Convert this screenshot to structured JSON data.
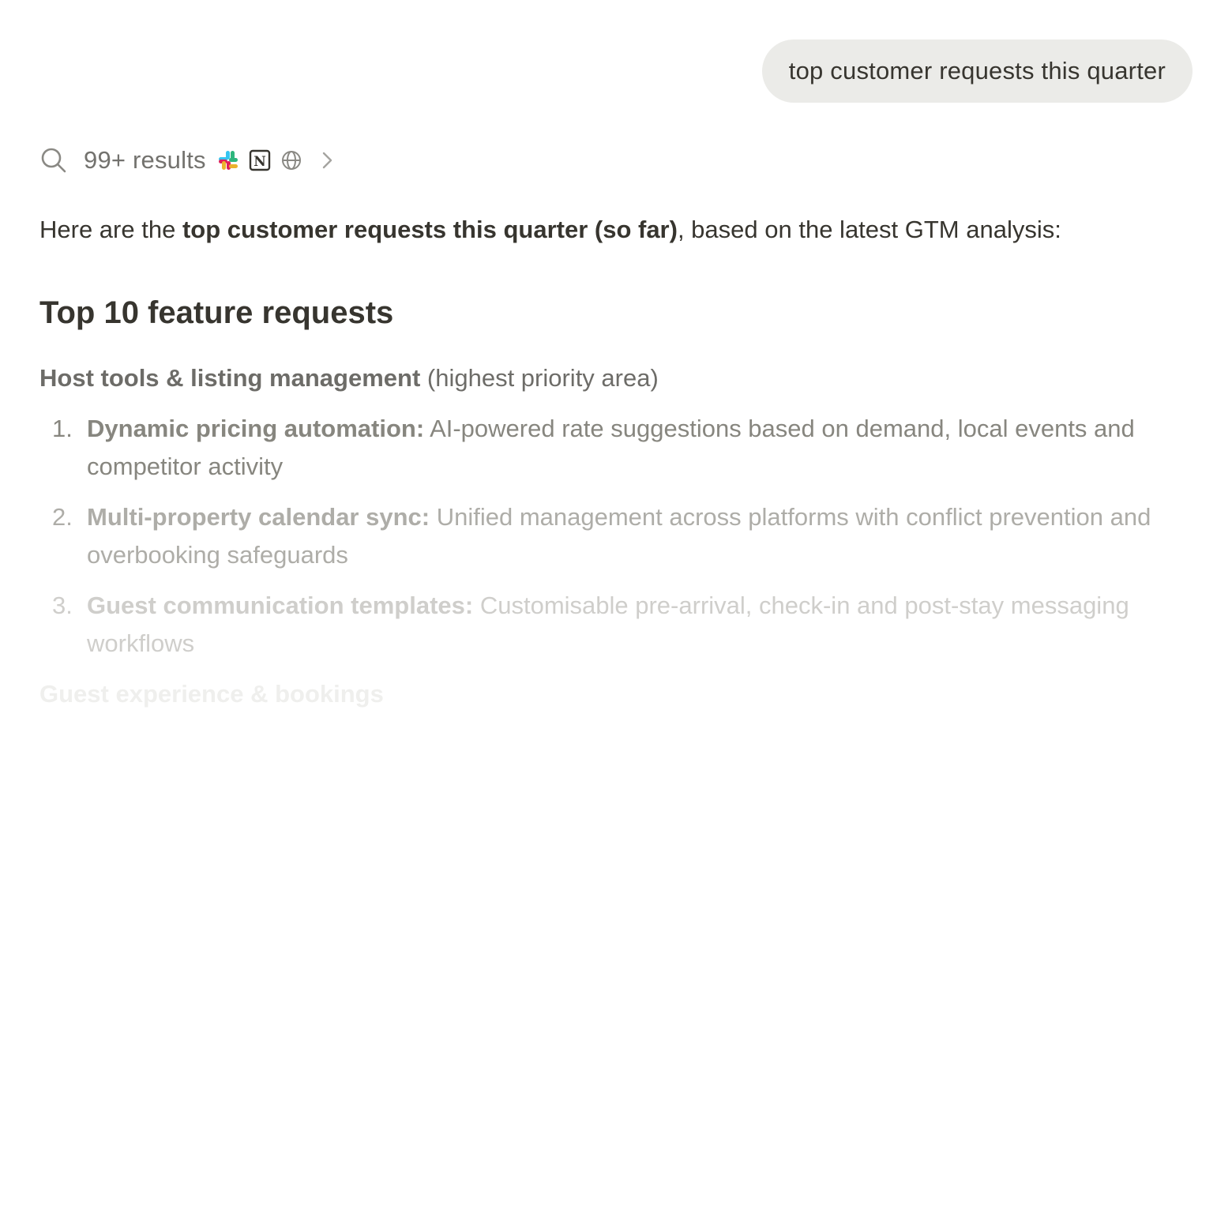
{
  "user_message": "top customer requests this quarter",
  "results": {
    "label": "99+ results",
    "sources": [
      "slack-icon",
      "notion-icon",
      "globe-icon"
    ]
  },
  "intro": {
    "prefix": "Here are the ",
    "bold": "top customer requests this quarter (so far)",
    "suffix": ", based on the latest GTM analysis:"
  },
  "heading": "Top 10 feature requests",
  "section_1": {
    "title": "Host tools & listing management",
    "note": " (highest priority area)"
  },
  "requests": [
    {
      "number": "1.",
      "title": "Dynamic pricing automation:",
      "description": " AI-powered rate suggestions based on demand, local events and competitor activity"
    },
    {
      "number": "2.",
      "title": "Multi-property calendar sync:",
      "description": " Unified management across platforms with conflict prevention and overbooking safeguards"
    },
    {
      "number": "3.",
      "title": "Guest communication templates:",
      "description": " Customisable pre-arrival, check-in and post-stay messaging workflows"
    }
  ],
  "section_2": {
    "title": "Guest experience & bookings"
  },
  "colors": {
    "bubble_bg": "#ebebe8",
    "text_primary": "#37352f",
    "text_muted": "#73726e"
  }
}
